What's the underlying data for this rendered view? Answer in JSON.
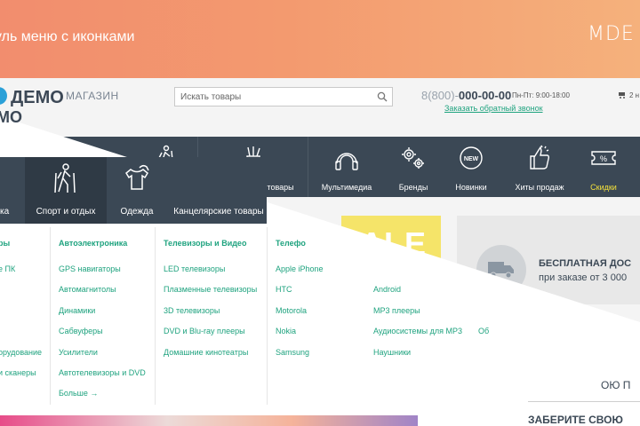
{
  "banner": {
    "title": "уль меню с иконками",
    "logo": "MDE"
  },
  "header": {
    "logo_main": "ДЕМО",
    "logo_sub": "МАГАЗИН",
    "logo_ghost": "МО",
    "search_placeholder": "Искать товары",
    "phone_prefix": "8(800)-",
    "phone_number": "000-00-00",
    "hours": "Пн-Пт: 9:00-18:00",
    "callback": "Заказать обратный звонок",
    "cart_text": "2 н"
  },
  "nav": {
    "items": [
      {
        "label": "к",
        "icon": "hiker-icon"
      },
      {
        "label": "Канцелярские товары",
        "icon": "pencil-cup-icon"
      },
      {
        "label": "Мультимедиа",
        "icon": "headphones-icon"
      },
      {
        "label": "Бренды",
        "icon": "gears-icon"
      },
      {
        "label": "Новинки",
        "icon": "new-badge-icon"
      },
      {
        "label": "Хиты продаж",
        "icon": "thumbs-up-icon"
      },
      {
        "label": "Скидки",
        "icon": "discount-ticket-icon"
      }
    ]
  },
  "promo": {
    "sale": "SALE",
    "delivery_title": "БЕСПЛАТНАЯ ДОС",
    "delivery_sub": "при заказе от 3 000",
    "line1": "ОЮ П",
    "line2": "ЗАБЕРИТЕ СВОЮ"
  },
  "front_nav": {
    "items": [
      {
        "label": "ка",
        "icon": "hiker-icon"
      },
      {
        "label": "Спорт и отдых",
        "icon": "hiker-icon"
      },
      {
        "label": "Одежда",
        "icon": "clothes-icon"
      },
      {
        "label": "Канцелярские товары",
        "icon": "pencil-cup-icon"
      }
    ]
  },
  "dropdown": {
    "col0": {
      "head": "ры",
      "links": [
        "е ПК",
        "",
        "",
        "орудование",
        "и сканеры"
      ]
    },
    "col1": {
      "head": "Автоэлектроника",
      "links": [
        "GPS навигаторы",
        "Автомагнитолы",
        "Динамики",
        "Сабвуферы",
        "Усилители",
        "Автотелевизоры и DVD",
        "Больше →"
      ]
    },
    "col2": {
      "head": "Телевизоры и Видео",
      "links": [
        "LED телевизоры",
        "Плазменные телевизоры",
        "3D телевизоры",
        "DVD и Blu-ray плееры",
        "Домашние кинотеатры"
      ]
    },
    "col3": {
      "head": "Телефо",
      "links": [
        "Apple iPhone",
        "HTC",
        "Motorola",
        "Nokia",
        "Samsung"
      ]
    },
    "col4": {
      "links": [
        "Android",
        "MP3 плееры",
        "Аудиосистемы для MP3",
        "Наушники"
      ]
    },
    "extra": "Об"
  }
}
